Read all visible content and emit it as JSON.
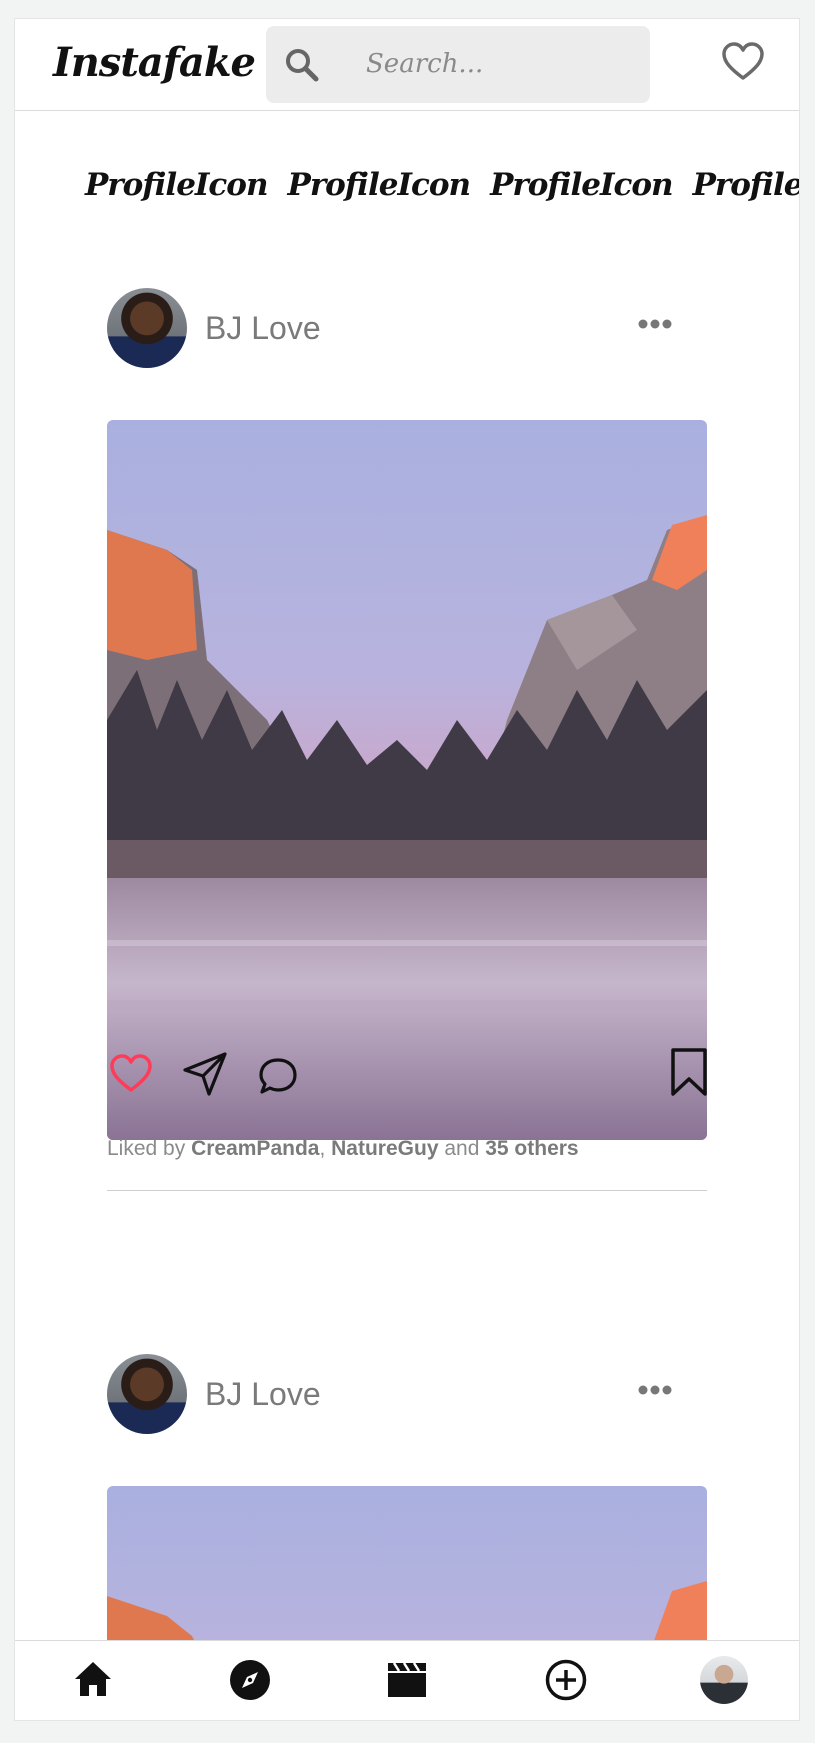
{
  "header": {
    "logo": "Instafake",
    "search_placeholder": "Search...",
    "heart_icon": "heart-outline-icon"
  },
  "stories": [
    {
      "label": "ProfileIcon"
    },
    {
      "label": "ProfileIcon"
    },
    {
      "label": "ProfileIcon"
    },
    {
      "label": "ProfileIcon"
    }
  ],
  "posts": [
    {
      "author": "BJ Love",
      "liked_by_prefix": "Liked by",
      "liked_user_1": "CreamPanda",
      "separator": ",",
      "liked_user_2": "NatureGuy",
      "and_text": "and",
      "others": "35 others"
    },
    {
      "author": "BJ Love"
    }
  ],
  "colors": {
    "like_red": "#ff3b57",
    "text_gray": "#7a7a7a",
    "divider": "#cfcfcf"
  },
  "bottom_nav": [
    {
      "icon": "home-icon"
    },
    {
      "icon": "explore-compass-icon"
    },
    {
      "icon": "reels-clapper-icon"
    },
    {
      "icon": "create-plus-icon"
    },
    {
      "icon": "profile-avatar"
    }
  ]
}
